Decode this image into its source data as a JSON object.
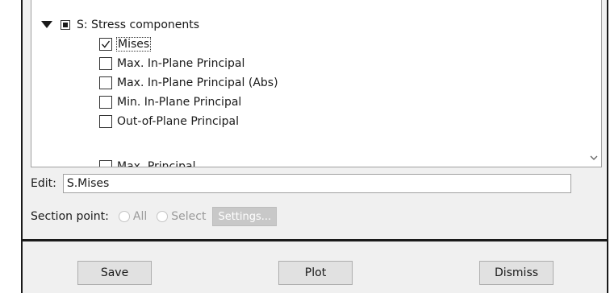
{
  "tree": {
    "group_label": "S: Stress components",
    "items": [
      {
        "label": "Mises",
        "checked": true
      },
      {
        "label": "Max. In-Plane Principal",
        "checked": false
      },
      {
        "label": "Max. In-Plane Principal (Abs)",
        "checked": false
      },
      {
        "label": "Min. In-Plane Principal",
        "checked": false
      },
      {
        "label": "Out-of-Plane Principal",
        "checked": false
      },
      {
        "label": "Max. Principal",
        "checked": false
      }
    ]
  },
  "edit": {
    "label": "Edit:",
    "value": "S.Mises"
  },
  "section_point": {
    "label": "Section point:",
    "option_all": "All",
    "option_select": "Select",
    "settings_label": "Settings..."
  },
  "buttons": {
    "save": "Save",
    "plot": "Plot",
    "dismiss": "Dismiss"
  }
}
